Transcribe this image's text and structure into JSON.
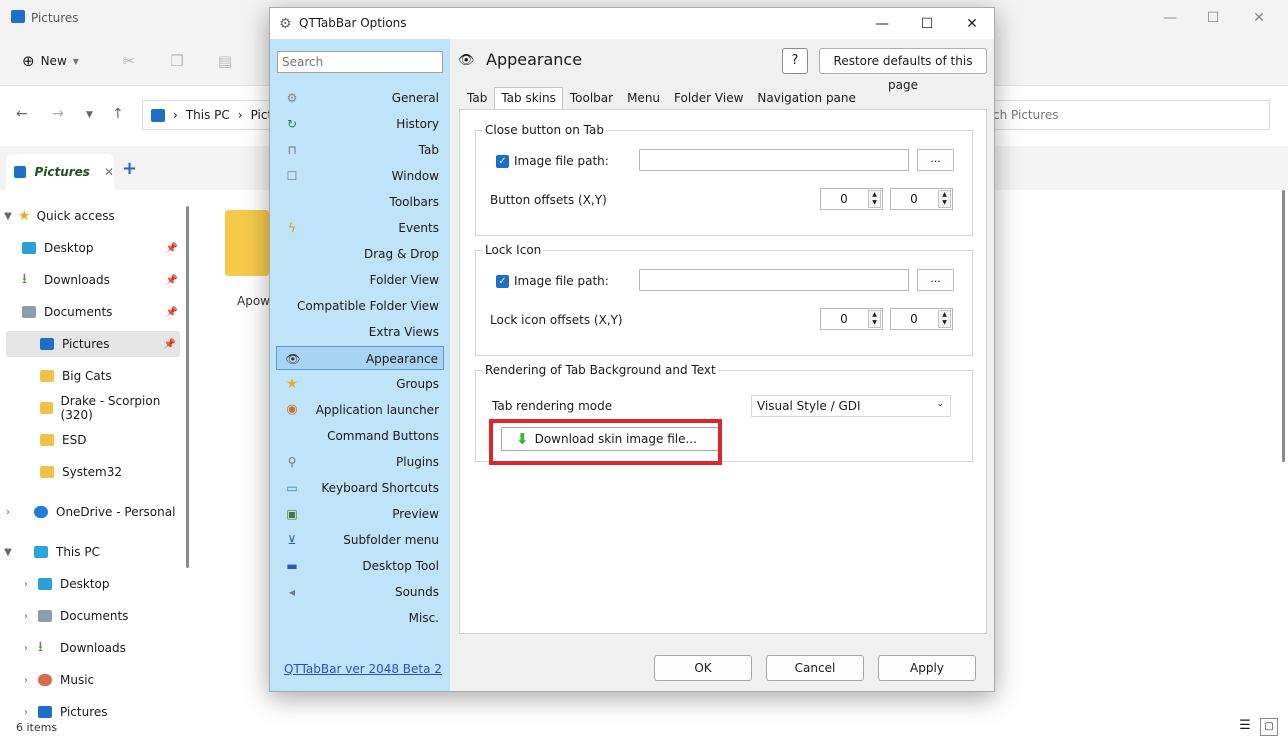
{
  "explorer": {
    "title": "Pictures",
    "new_label": "New",
    "address_crumbs": [
      "This PC",
      "Pict"
    ],
    "search_placeholder": "ch Pictures",
    "tab_label": "Pictures",
    "folder_label": "Apow",
    "status": "6 items",
    "sidebar": {
      "quick_access": "Quick access",
      "items": [
        "Desktop",
        "Downloads",
        "Documents",
        "Pictures",
        "Big Cats",
        "Drake - Scorpion (320)",
        "ESD",
        "System32"
      ],
      "onedrive": "OneDrive - Personal",
      "this_pc": "This PC",
      "this_pc_items": [
        "Desktop",
        "Documents",
        "Downloads",
        "Music",
        "Pictures"
      ]
    }
  },
  "dialog": {
    "title": "QTTabBar Options",
    "search_placeholder": "Search",
    "nav": [
      "General",
      "History",
      "Tab",
      "Window",
      "Toolbars",
      "Events",
      "Drag & Drop",
      "Folder View",
      "Compatible Folder View",
      "Extra Views",
      "Appearance",
      "Groups",
      "Application launcher",
      "Command Buttons",
      "Plugins",
      "Keyboard Shortcuts",
      "Preview",
      "Subfolder menu",
      "Desktop Tool",
      "Sounds",
      "Misc."
    ],
    "selected_nav": "Appearance",
    "version_link": "QTTabBar ver 2048 Beta 2",
    "page_title": "Appearance",
    "help_label": "?",
    "restore_label": "Restore defaults of this page",
    "tabs": [
      "Tab",
      "Tab skins",
      "Toolbar",
      "Menu",
      "Folder View",
      "Navigation pane"
    ],
    "active_tab": "Tab skins",
    "close_group": {
      "title": "Close button on Tab",
      "image_label": "Image file path:",
      "image_value": "",
      "browse_label": "...",
      "offsets_label": "Button offsets (X,Y)",
      "x": "0",
      "y": "0"
    },
    "lock_group": {
      "title": "Lock Icon",
      "image_label": "Image file path:",
      "image_value": "",
      "browse_label": "...",
      "offsets_label": "Lock icon offsets (X,Y)",
      "x": "0",
      "y": "0"
    },
    "render_group": {
      "title": "Rendering of Tab Background and Text",
      "mode_label": "Tab rendering mode",
      "mode_value": "Visual Style / GDI",
      "download_label": "Download skin image file..."
    },
    "buttons": {
      "ok": "OK",
      "cancel": "Cancel",
      "apply": "Apply"
    }
  },
  "colors": {
    "nav_bg": "#bfe3f8",
    "selected_bg": "#a9d3f2",
    "accent": "#1b6fc9",
    "highlight": "#e0242c"
  }
}
